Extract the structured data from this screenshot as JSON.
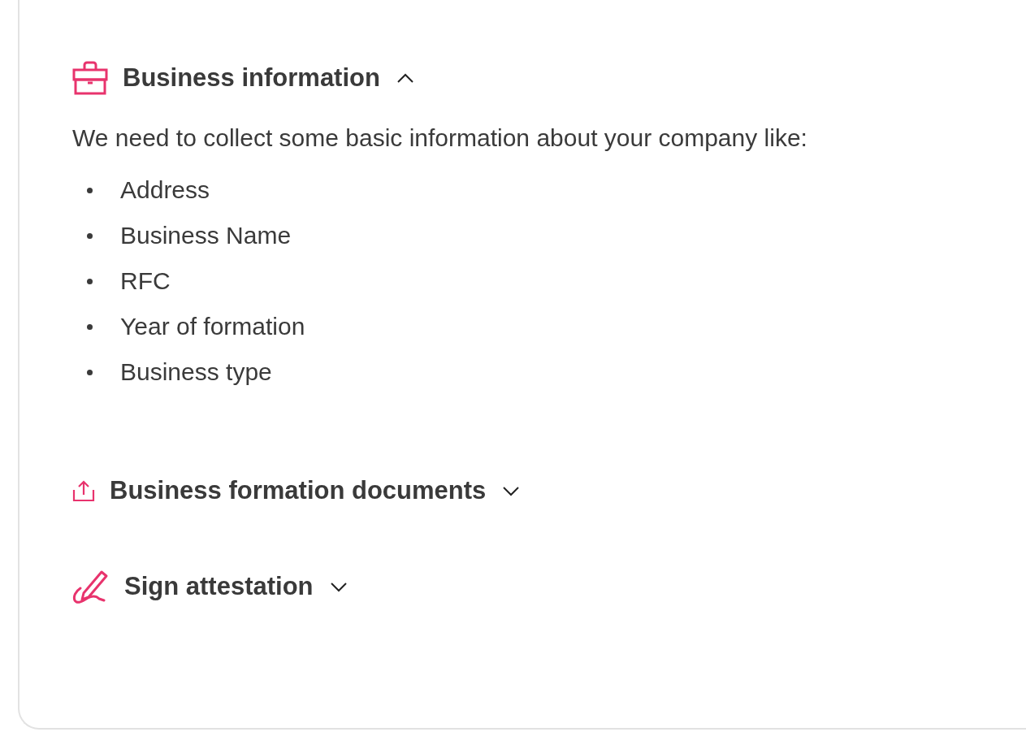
{
  "sections": [
    {
      "kind": "briefcase",
      "title": "Business information",
      "expanded": true,
      "description": "We need to collect some basic information about your company like:",
      "items": [
        "Address",
        "Business Name",
        "RFC",
        "Year of formation",
        "Business type"
      ]
    },
    {
      "kind": "upload",
      "title": "Business formation documents",
      "expanded": false
    },
    {
      "kind": "signature",
      "title": "Sign attestation",
      "expanded": false
    }
  ]
}
